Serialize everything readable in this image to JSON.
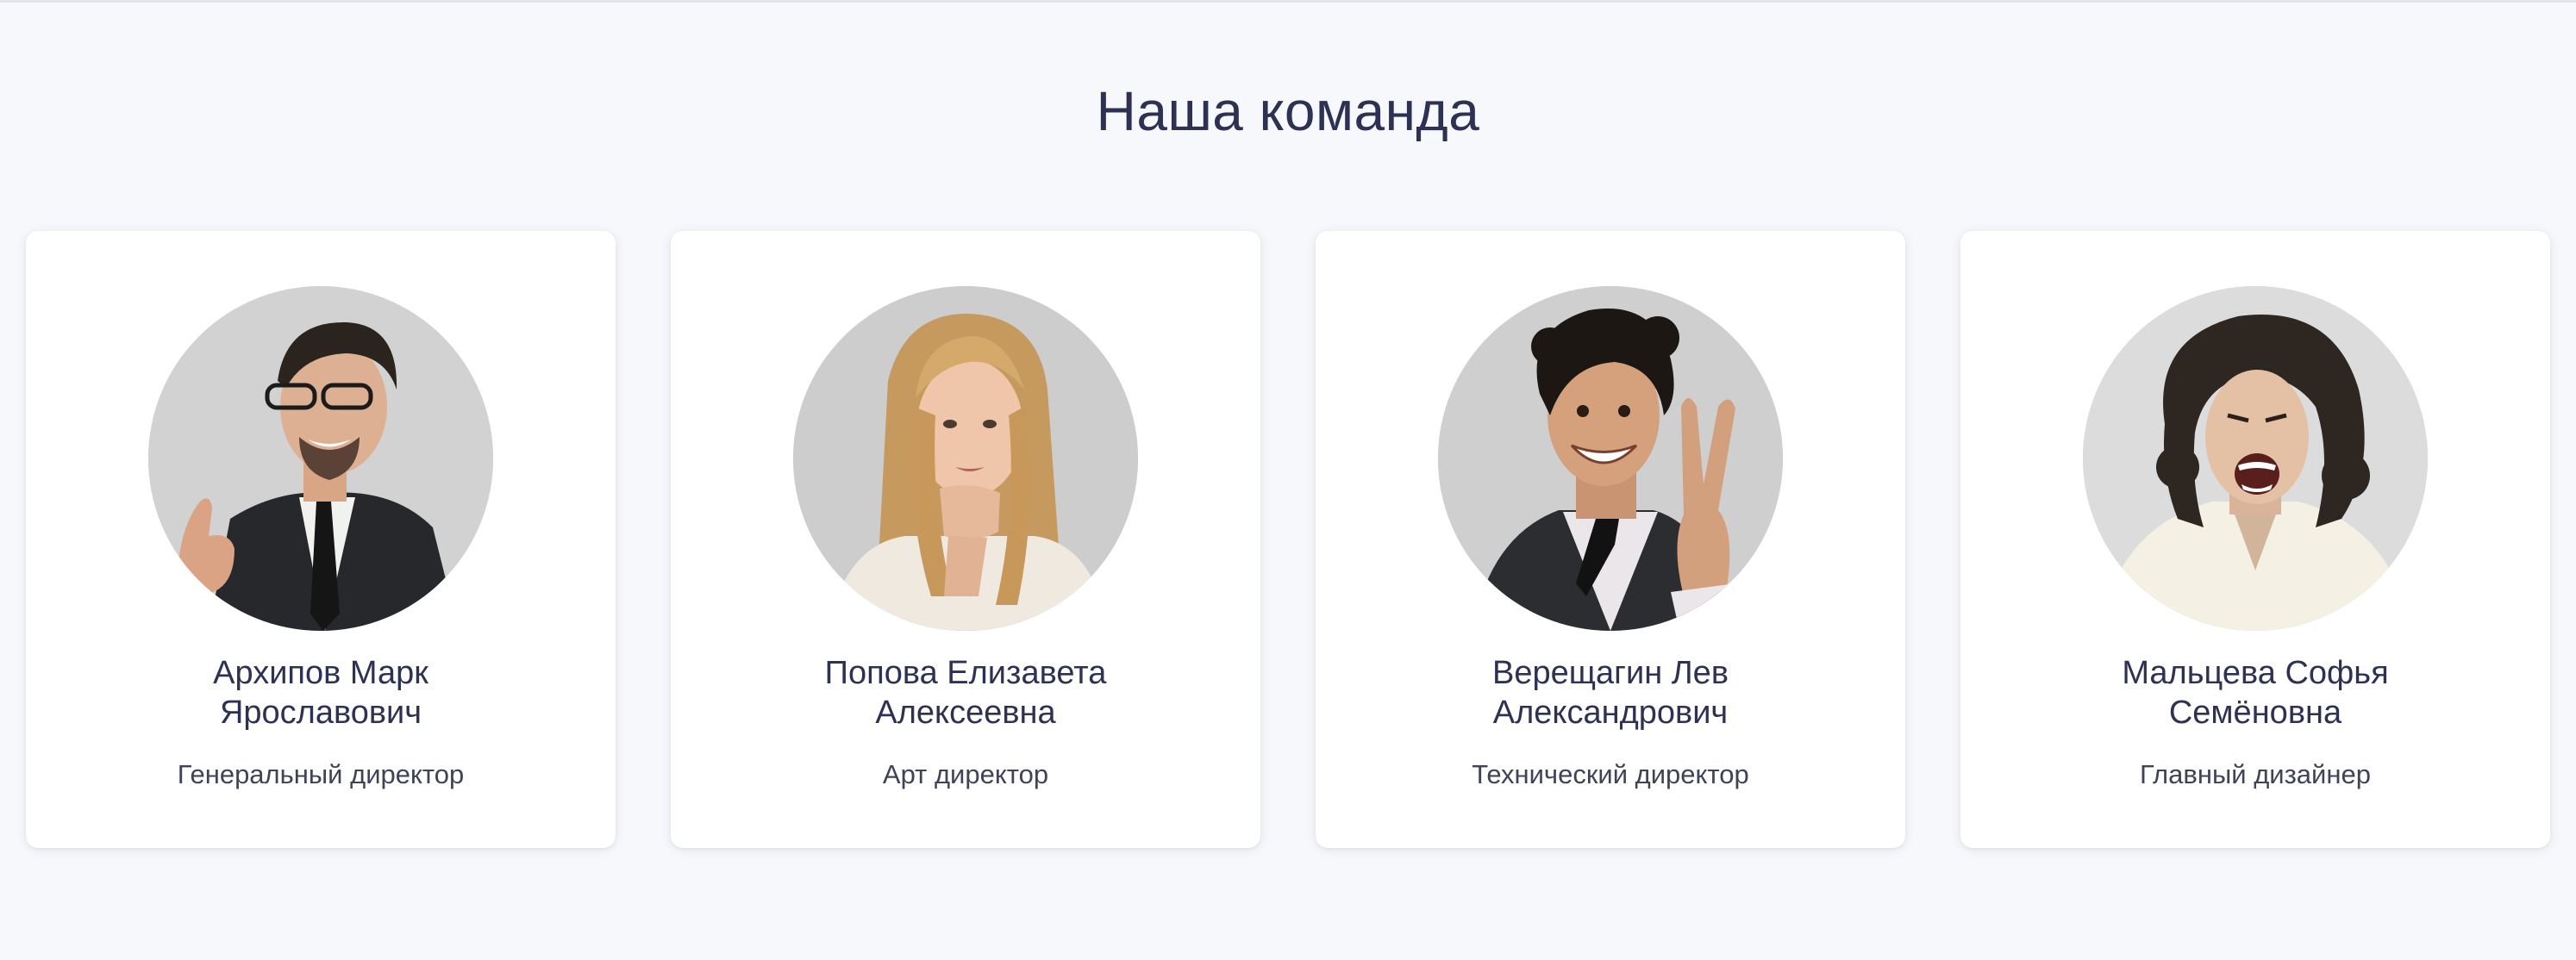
{
  "section": {
    "title": "Наша команда"
  },
  "team": [
    {
      "name_line1": "Архипов Марк",
      "name_line2": "Ярославович",
      "role": "Генеральный директор",
      "photo_icon": "person-photo-thumbs-up"
    },
    {
      "name_line1": "Попова Елизавета",
      "name_line2": "Алексеевна",
      "role": "Арт директор",
      "photo_icon": "person-photo-thinking"
    },
    {
      "name_line1": "Верещагин Лев",
      "name_line2": "Александрович",
      "role": "Технический директор",
      "photo_icon": "person-photo-peace-sign"
    },
    {
      "name_line1": "Мальцева Софья",
      "name_line2": "Семёновна",
      "role": "Главный дизайнер",
      "photo_icon": "person-photo-screaming"
    }
  ],
  "colors": {
    "background": "#f7f8fb",
    "card": "#ffffff",
    "heading_text": "#2d3153",
    "body_text": "#3f4358"
  }
}
